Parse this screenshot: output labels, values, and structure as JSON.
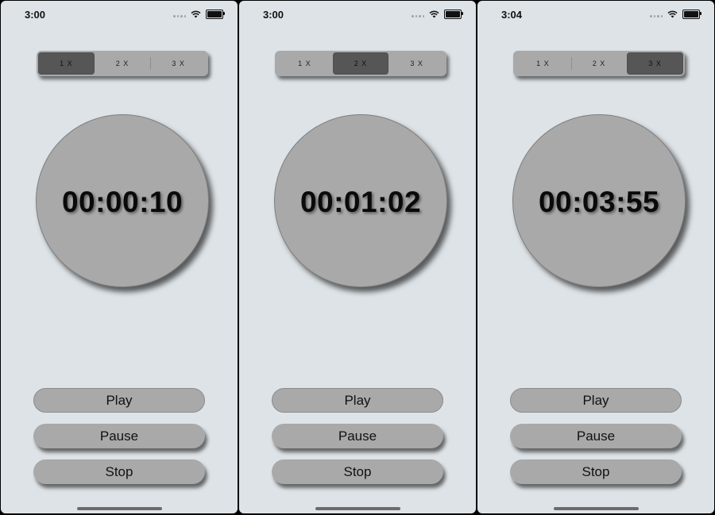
{
  "screens": [
    {
      "status_time": "3:00",
      "segments": [
        "1 X",
        "2 X",
        "3 X"
      ],
      "selected_segment": 0,
      "timer": "00:00:10",
      "buttons": {
        "play": "Play",
        "pause": "Pause",
        "stop": "Stop"
      }
    },
    {
      "status_time": "3:00",
      "segments": [
        "1 X",
        "2 X",
        "3 X"
      ],
      "selected_segment": 1,
      "timer": "00:01:02",
      "buttons": {
        "play": "Play",
        "pause": "Pause",
        "stop": "Stop"
      }
    },
    {
      "status_time": "3:04",
      "segments": [
        "1 X",
        "2 X",
        "3 X"
      ],
      "selected_segment": 2,
      "timer": "00:03:55",
      "buttons": {
        "play": "Play",
        "pause": "Pause",
        "stop": "Stop"
      }
    }
  ],
  "icons": {
    "signal": "cellular-dots-icon",
    "wifi": "wifi-icon",
    "battery": "battery-icon"
  },
  "colors": {
    "background": "#dde3e7",
    "control": "#a9a9a9",
    "selected_segment": "#565656",
    "text": "#111111"
  }
}
